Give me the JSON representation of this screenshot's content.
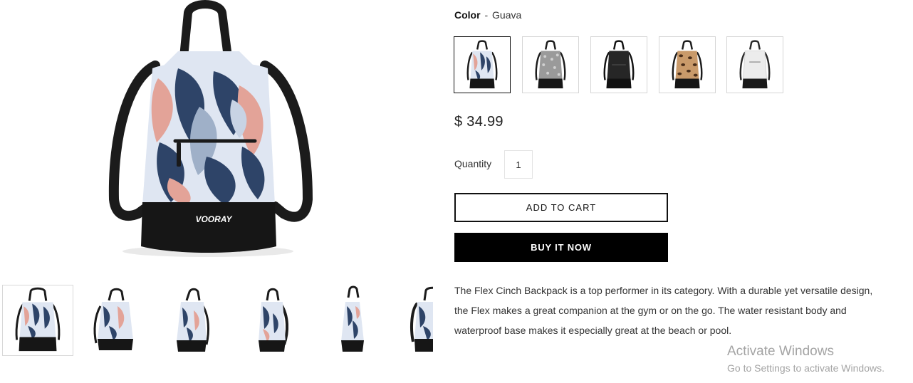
{
  "product": {
    "color_label": "Color",
    "color_separator": "-",
    "color_value": "Guava",
    "price": "$ 34.99",
    "quantity_label": "Quantity",
    "quantity_value": "1",
    "add_to_cart_label": "ADD TO CART",
    "buy_now_label": "BUY IT NOW",
    "description": "The Flex Cinch Backpack is a top performer in its category. With a durable yet versatile design, the Flex makes a great companion at the gym or on the go. The water resistant body and waterproof base makes it especially great at the beach or pool.",
    "brand_on_bag": "VOORAY"
  },
  "swatches": [
    {
      "name": "guava",
      "color": "#2e4468",
      "accent": "#e3a398",
      "selected": true
    },
    {
      "name": "grey-pattern",
      "color": "#8a8a8a",
      "accent": "#d0d0d0",
      "selected": false
    },
    {
      "name": "black",
      "color": "#1a1a1a",
      "accent": "#3a3a3a",
      "selected": false
    },
    {
      "name": "leopard",
      "color": "#8b5e3c",
      "accent": "#d9b48a",
      "selected": false
    },
    {
      "name": "white",
      "color": "#eeeeee",
      "accent": "#d5d5d5",
      "selected": false
    }
  ],
  "thumbnails": [
    {
      "view": "front",
      "active": true
    },
    {
      "view": "angle-left",
      "active": false
    },
    {
      "view": "side-left",
      "active": false
    },
    {
      "view": "side",
      "active": false
    },
    {
      "view": "side-right",
      "active": false
    },
    {
      "view": "back",
      "active": false
    }
  ],
  "watermark": {
    "title": "Activate Windows",
    "subtitle": "Go to Settings to activate Windows."
  },
  "colors": {
    "text": "#222222",
    "button_dark": "#000000",
    "bag_navy": "#2e4468",
    "bag_pink": "#e3a398",
    "bag_light": "#dfe6f2",
    "bag_base": "#161616"
  }
}
